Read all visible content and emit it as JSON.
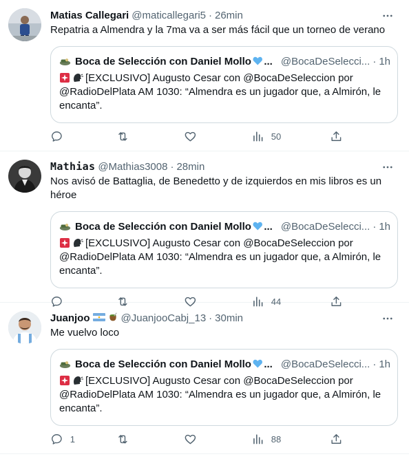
{
  "colors": {
    "text": "#0f1419",
    "secondary": "#536471",
    "border": "#cfd9de",
    "heart": "#5eb3f0"
  },
  "tweets": [
    {
      "name": "Matias Callegari",
      "handle": "@maticallegari5",
      "separator": "·",
      "time": "26min",
      "text": "Repatria a Almendra y la 7ma va a ser más fácil que un torneo de verano",
      "quote": {
        "name": "Boca de Selección con Daniel Mollo",
        "ellipsis": "...",
        "handle": "@BocaDeSelecci...",
        "separator": "·",
        "time": "1h",
        "text": "[EXCLUSIVO] Augusto Cesar con @BocaDeSeleccion por @RadioDelPlata AM 1030: “Almendra es un jugador que, a Almirón, le encanta”."
      },
      "stats": {
        "replies": "",
        "retweets": "",
        "likes": "",
        "views": "50"
      }
    },
    {
      "name": "Mathias",
      "handle": "@Mathias3008",
      "separator": "·",
      "time": "28min",
      "text": "Nos avisó de Battaglia, de Benedetto y de izquierdos en mis libros es un héroe",
      "quote": {
        "name": "Boca de Selección con Daniel Mollo",
        "ellipsis": "...",
        "handle": "@BocaDeSelecci...",
        "separator": "·",
        "time": "1h",
        "text": "[EXCLUSIVO] Augusto Cesar con @BocaDeSeleccion por @RadioDelPlata AM 1030: “Almendra es un jugador que, a Almirón, le encanta”."
      },
      "stats": {
        "replies": "",
        "retweets": "",
        "likes": "",
        "views": "44"
      }
    },
    {
      "name": "Juanjoo",
      "handle": "@JuanjooCabj_13",
      "separator": "·",
      "time": "30min",
      "text": "Me vuelvo loco",
      "quote": {
        "name": "Boca de Selección con Daniel Mollo",
        "ellipsis": "...",
        "handle": "@BocaDeSelecci...",
        "separator": "·",
        "time": "1h",
        "text": "[EXCLUSIVO] Augusto Cesar con @BocaDeSeleccion por @RadioDelPlata AM 1030: “Almendra es un jugador que, a Almirón, le encanta”."
      },
      "stats": {
        "replies": "1",
        "retweets": "",
        "likes": "",
        "views": "88"
      }
    }
  ],
  "icons": {
    "more": "more-icon",
    "reply": "reply-icon",
    "retweet": "retweet-icon",
    "like": "like-icon",
    "views": "views-icon",
    "share": "share-icon",
    "siren": "siren-emoji",
    "speaking": "speaking-head-emoji",
    "heart": "blue-heart-emoji",
    "flag": "argentina-flag-emoji",
    "mate": "mate-emoji"
  }
}
